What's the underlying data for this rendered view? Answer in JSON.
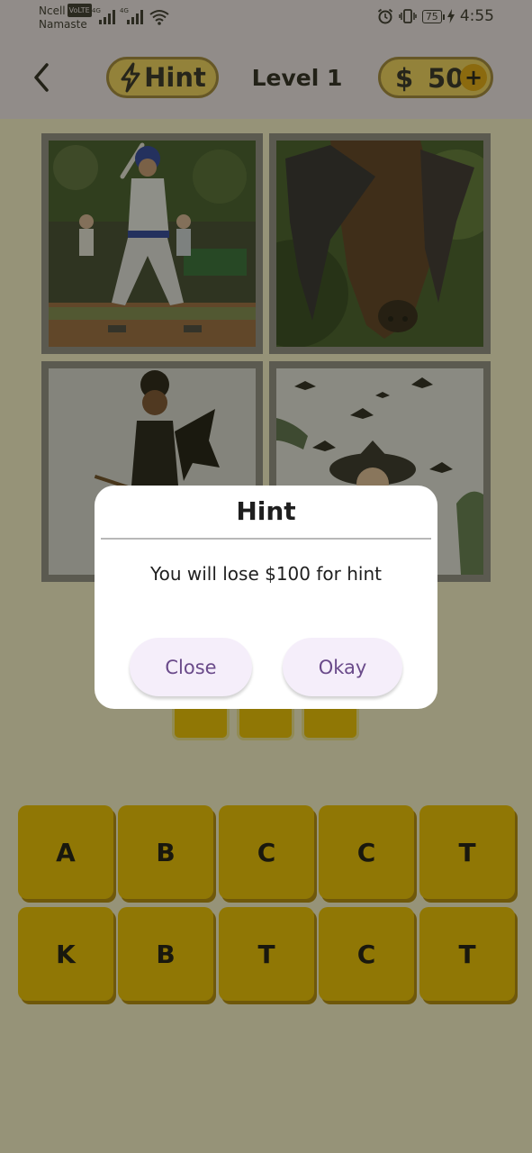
{
  "status_bar": {
    "carrier": "Ncell",
    "volte": "VoLTE",
    "network_name": "Namaste",
    "signal_1_type": "4G",
    "signal_2_type": "4G",
    "battery": "75",
    "time": "4:55"
  },
  "header": {
    "hint_label": "Hint",
    "level_label": "Level 1",
    "currency_symbol": "$",
    "coins": "50",
    "add_coins_label": "+"
  },
  "images": [
    {
      "icon": "baseball-batter-photo"
    },
    {
      "icon": "hanging-bat-photo"
    },
    {
      "icon": "girl-bat-costume-photo"
    },
    {
      "icon": "halloween-bats-witch-photo"
    }
  ],
  "answer_slots": [
    "",
    "",
    ""
  ],
  "letters_row1": [
    "A",
    "B",
    "C",
    "C",
    "T"
  ],
  "letters_row2": [
    "K",
    "B",
    "T",
    "C",
    "T"
  ],
  "dialog": {
    "title": "Hint",
    "message": "You will lose $100 for hint",
    "close_label": "Close",
    "okay_label": "Okay"
  },
  "colors": {
    "accent_yellow": "#f2c400",
    "dialog_button_bg": "#f5eefa",
    "dialog_button_text": "#6a4a8a"
  }
}
